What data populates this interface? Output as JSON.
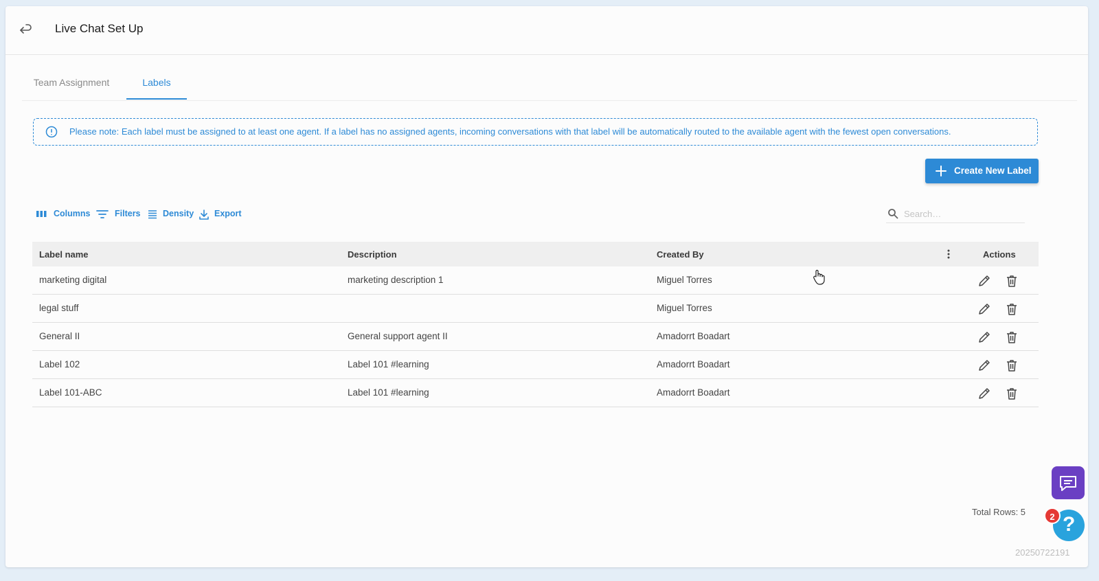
{
  "header": {
    "title": "Live Chat Set Up",
    "back_icon": "undo-arrow-icon"
  },
  "tabs": [
    {
      "label": "Team Assignment",
      "active": false
    },
    {
      "label": "Labels",
      "active": true
    }
  ],
  "notice": {
    "icon": "info-circle-icon",
    "text": "Please note: Each label must be assigned to at least one agent. If a label has no assigned agents, incoming conversations with that label will be automatically routed to the available agent with the fewest open conversations."
  },
  "actions": {
    "create_label": "Create New Label"
  },
  "toolbar": {
    "columns": "Columns",
    "filters": "Filters",
    "density": "Density",
    "export": "Export"
  },
  "search": {
    "placeholder": "Search…",
    "value": ""
  },
  "table": {
    "headers": {
      "name": "Label name",
      "description": "Description",
      "created_by": "Created By",
      "actions": "Actions"
    },
    "rows": [
      {
        "name": "marketing digital",
        "description": "marketing description 1",
        "created_by": "Miguel Torres"
      },
      {
        "name": "legal stuff",
        "description": "",
        "created_by": "Miguel Torres"
      },
      {
        "name": "General II",
        "description": "General support agent II",
        "created_by": "Amadorrt Boadart"
      },
      {
        "name": "Label 102",
        "description": "Label 101 #learning",
        "created_by": "Amadorrt Boadart"
      },
      {
        "name": "Label 101-ABC",
        "description": "Label 101 #learning",
        "created_by": "Amadorrt Boadart"
      }
    ]
  },
  "footer": {
    "total_rows": "Total Rows: 5"
  },
  "widgets": {
    "help_badge_count": "2",
    "build_id": "20250722191"
  },
  "colors": {
    "accent": "#2d8ad6",
    "chat_widget": "#6a3fc3",
    "help_widget": "#29a3dd",
    "badge": "#e53935"
  }
}
